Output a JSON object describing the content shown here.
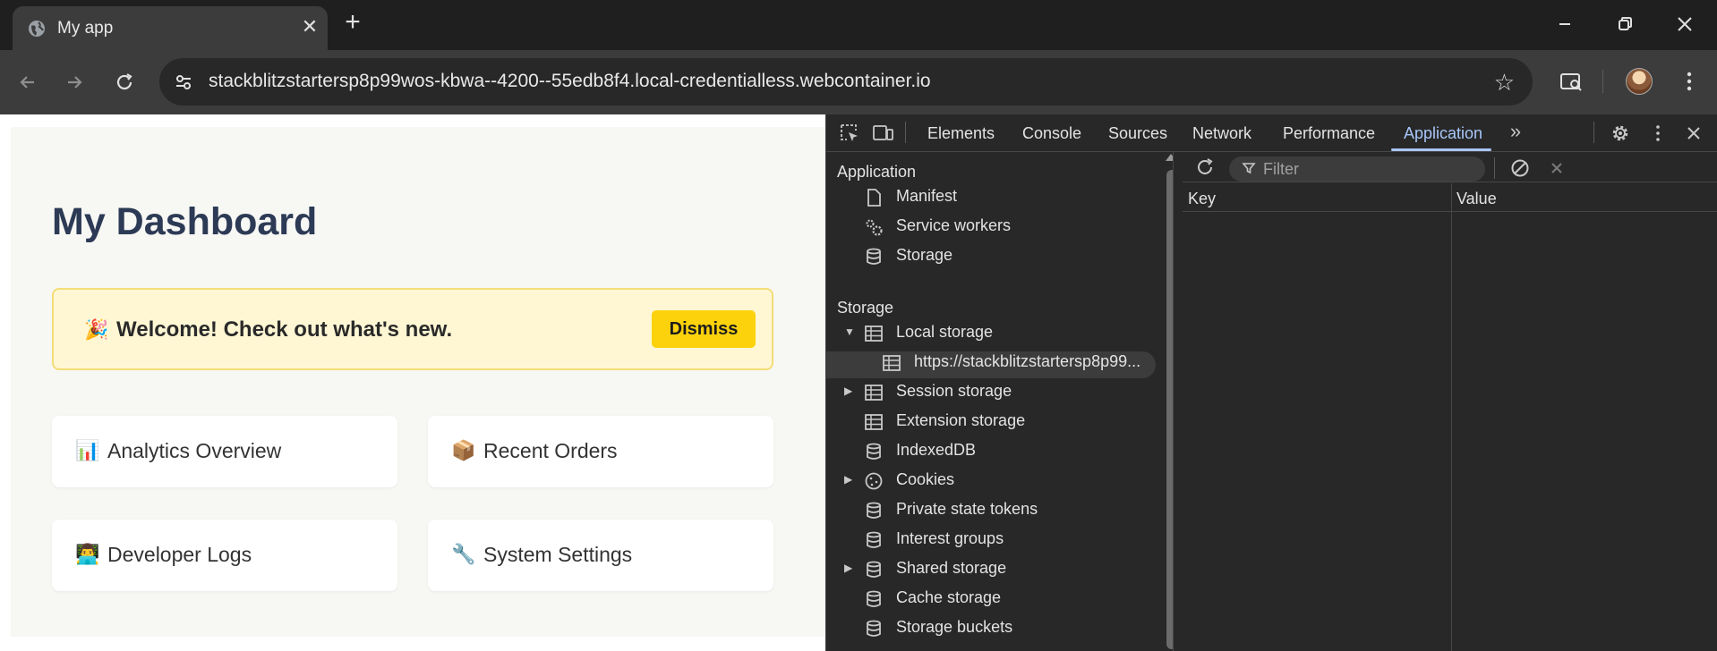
{
  "browser": {
    "tab_title": "My app",
    "url": "stackblitzstartersp8p99wos-kbwa--4200--55edb8f4.local-credentialless.webcontainer.io"
  },
  "page": {
    "title": "My Dashboard",
    "banner": {
      "emoji": "🎉",
      "message": "Welcome! Check out what's new.",
      "dismiss_label": "Dismiss"
    },
    "cards": [
      {
        "icon": "📊",
        "label": "Analytics Overview"
      },
      {
        "icon": "📦",
        "label": "Recent Orders"
      },
      {
        "icon": "👨‍💻",
        "label": "Developer Logs"
      },
      {
        "icon": "🔧",
        "label": "System Settings"
      }
    ]
  },
  "devtools": {
    "tabs": [
      "Elements",
      "Console",
      "Sources",
      "Network",
      "Performance",
      "Application"
    ],
    "active_tab": "Application",
    "accent_color": "#a8c7fa",
    "sidebar": {
      "application_header": "Application",
      "application_items": [
        "Manifest",
        "Service workers",
        "Storage"
      ],
      "storage_header": "Storage",
      "storage_items": [
        "Local storage",
        "https://stackblitzstartersp8p99...",
        "Session storage",
        "Extension storage",
        "IndexedDB",
        "Cookies",
        "Private state tokens",
        "Interest groups",
        "Shared storage",
        "Cache storage",
        "Storage buckets"
      ]
    },
    "panel": {
      "filter_placeholder": "Filter",
      "columns": [
        "Key",
        "Value"
      ]
    }
  }
}
